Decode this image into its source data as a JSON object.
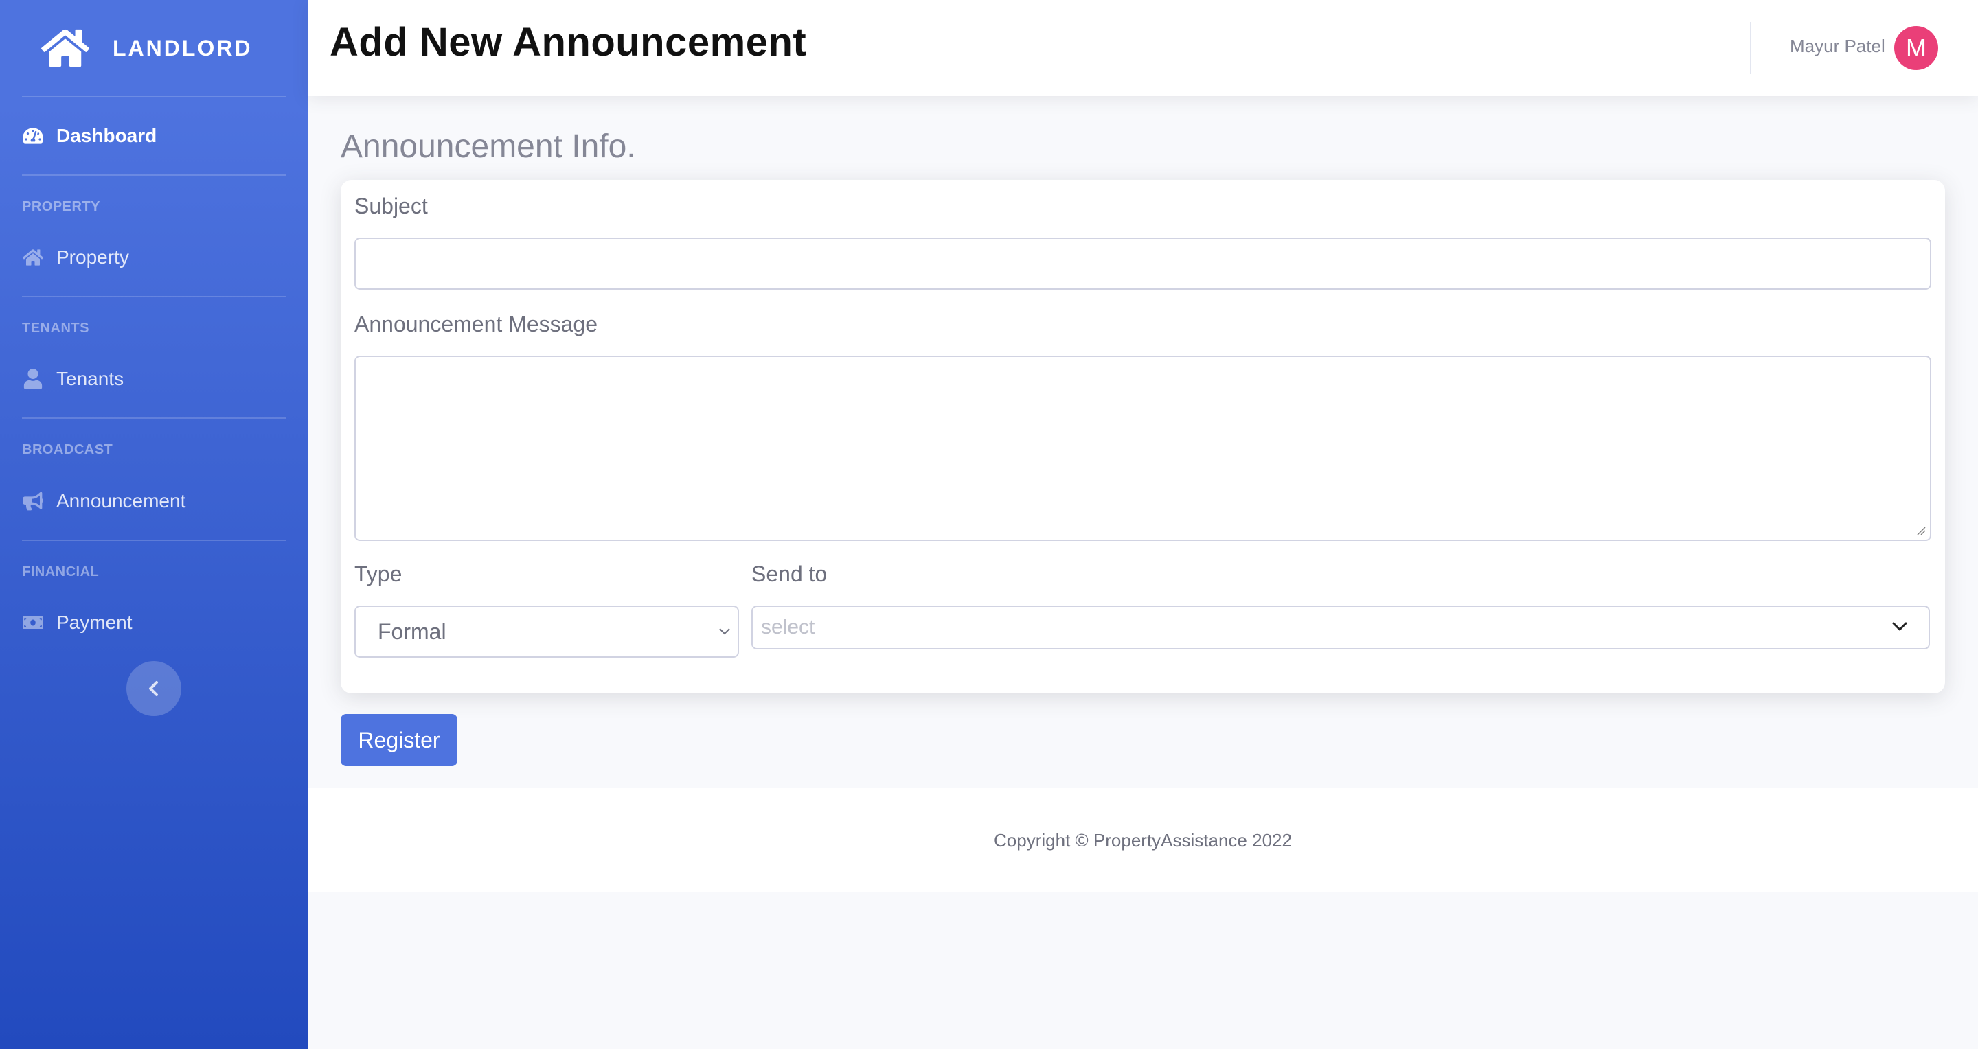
{
  "sidebar": {
    "brand": "LANDLORD",
    "items": [
      {
        "label": "Dashboard",
        "icon": "tachometer-icon"
      },
      {
        "heading": "PROPERTY",
        "label": "Property",
        "icon": "home-icon"
      },
      {
        "heading": "TENANTS",
        "label": "Tenants",
        "icon": "user-icon"
      },
      {
        "heading": "BROADCAST",
        "label": "Announcement",
        "icon": "bullhorn-icon"
      },
      {
        "heading": "FINANCIAL",
        "label": "Payment",
        "icon": "money-bill-icon"
      }
    ],
    "toggle_icon": "chevron-left-icon"
  },
  "header": {
    "title": "Add New Announcement",
    "user_name": "Mayur Patel",
    "avatar_initial": "M",
    "avatar_color": "#ea3f78"
  },
  "form": {
    "section_title": "Announcement Info.",
    "subject_label": "Subject",
    "subject_value": "",
    "message_label": "Announcement Message",
    "message_value": "",
    "type_label": "Type",
    "type_selected": "Formal",
    "send_to_label": "Send to",
    "send_to_placeholder": "select",
    "submit_label": "Register"
  },
  "footer": {
    "copyright": "Copyright © PropertyAssistance 2022"
  },
  "colors": {
    "primary": "#4e73df",
    "sidebar_gradient_end": "#224abe"
  }
}
